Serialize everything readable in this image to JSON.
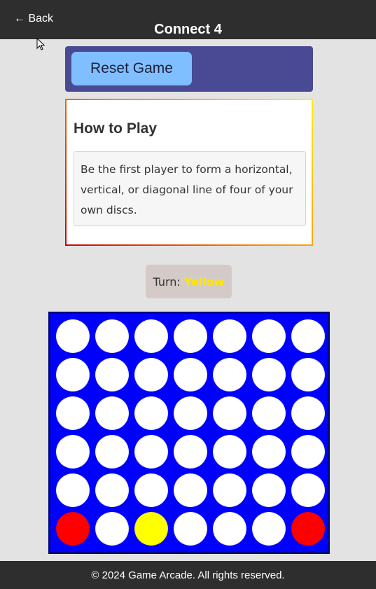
{
  "header": {
    "back_label": "← Back",
    "title": "Connect 4"
  },
  "controls": {
    "reset_label": "Reset Game"
  },
  "how_to_play": {
    "title": "How to Play",
    "text": "Be the first player to form a horizontal, vertical, or diagonal line of four of your own discs."
  },
  "turn": {
    "label": "Turn:",
    "player": "Yellow"
  },
  "board": {
    "rows": 6,
    "columns": 7,
    "cells": [
      [
        "empty",
        "empty",
        "empty",
        "empty",
        "empty",
        "empty",
        "empty"
      ],
      [
        "empty",
        "empty",
        "empty",
        "empty",
        "empty",
        "empty",
        "empty"
      ],
      [
        "empty",
        "empty",
        "empty",
        "empty",
        "empty",
        "empty",
        "empty"
      ],
      [
        "empty",
        "empty",
        "empty",
        "empty",
        "empty",
        "empty",
        "empty"
      ],
      [
        "empty",
        "empty",
        "empty",
        "empty",
        "empty",
        "empty",
        "empty"
      ],
      [
        "red",
        "empty",
        "yellow",
        "empty",
        "empty",
        "empty",
        "red"
      ]
    ],
    "colors": {
      "board": "#0000ff",
      "empty": "#ffffff",
      "red": "#ff0000",
      "yellow": "#ffff00"
    }
  },
  "footer": {
    "text": "© 2024 Game Arcade. All rights reserved."
  }
}
